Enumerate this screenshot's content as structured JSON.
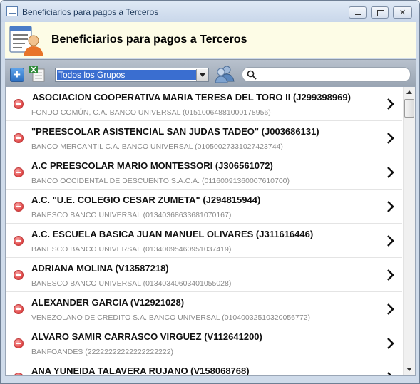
{
  "window": {
    "title": "Beneficiarios para pagos a Terceros"
  },
  "header": {
    "title": "Beneficiarios para pagos a Terceros",
    "icon": "contact-list-person-icon"
  },
  "toolbar": {
    "add_icon": "plus-icon",
    "excel_icon": "excel-export-icon",
    "group_select": {
      "selected": "Todos los Grupos"
    },
    "groups_icon": "users-group-icon",
    "search": {
      "value": "",
      "placeholder": ""
    }
  },
  "beneficiaries": [
    {
      "name": "ASOCIACION COOPERATIVA MARIA TERESA DEL TORO II (J299398969)",
      "bank": "FONDO COMÚN, C.A. BANCO UNIVERSAL (01510064881000178956)"
    },
    {
      "name": "\"PREESCOLAR ASISTENCIAL SAN JUDAS TADEO\" (J003686131)",
      "bank": "BANCO MERCANTIL C.A. BANCO UNIVERSAL (01050027331027423744)"
    },
    {
      "name": "A.C PREESCOLAR MARIO MONTESSORI (J306561072)",
      "bank": "BANCO OCCIDENTAL DE DESCUENTO S.A.C.A. (01160091360007610700)"
    },
    {
      "name": "A.C. \"U.E. COLEGIO CESAR ZUMETA\" (J294815944)",
      "bank": "BANESCO BANCO UNIVERSAL (01340368633681070167)"
    },
    {
      "name": "A.C. ESCUELA BASICA JUAN MANUEL OLIVARES (J311616446)",
      "bank": "BANESCO BANCO UNIVERSAL (01340095460951037419)"
    },
    {
      "name": "ADRIANA MOLINA (V13587218)",
      "bank": "BANESCO BANCO UNIVERSAL (01340340603401055028)"
    },
    {
      "name": "ALEXANDER GARCIA (V12921028)",
      "bank": "VENEZOLANO DE CREDITO S.A. BANCO UNIVERSAL (01040032510320056772)"
    },
    {
      "name": "ALVARO SAMIR CARRASCO VIRGUEZ (V112641200)",
      "bank": "BANFOANDES (22222222222222222222)"
    },
    {
      "name": "ANA YUNEIDA TALAVERA RUJANO (V158068768)",
      "bank": ""
    }
  ],
  "colors": {
    "delete_red": "#e04545",
    "select_highlight": "#3a6ed0",
    "header_bg": "#fdfce6"
  }
}
